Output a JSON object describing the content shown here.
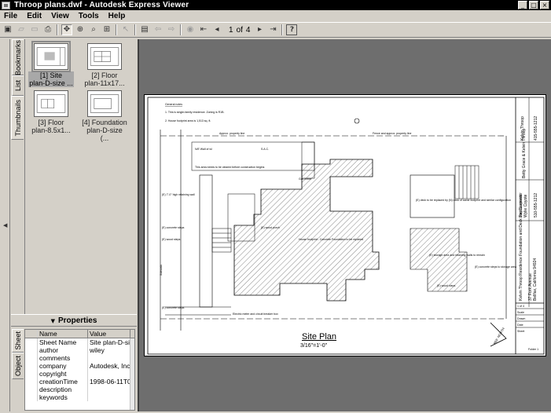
{
  "window": {
    "title": "Throop plans.dwf - Autodesk Express Viewer",
    "controls": [
      "_",
      "□",
      "×"
    ]
  },
  "menu": [
    "File",
    "Edit",
    "View",
    "Tools",
    "Help"
  ],
  "toolbar": {
    "page_current": "1",
    "page_of": "of",
    "page_total": "4"
  },
  "left_tabs": [
    "Bookmarks",
    "List",
    "Thumbnails"
  ],
  "thumbnails": [
    {
      "label": "[1] Site plan-D-size ...",
      "line1": "[1] Site",
      "line2": "plan-D-size ..."
    },
    {
      "label": "[2] Floor plan-11x17...",
      "line1": "[2] Floor",
      "line2": "plan-11x17..."
    },
    {
      "label": "[3] Floor plan-8.5x1...",
      "line1": "[3] Floor",
      "line2": "plan-8.5x1..."
    },
    {
      "label": "[4] Foundation plan-D-size (...",
      "line1": "[4] Foundation",
      "line2": "plan-D-size (..."
    }
  ],
  "properties": {
    "header": "Properties",
    "tabs": [
      "Sheet",
      "Object"
    ],
    "columns": [
      "Name",
      "Value"
    ],
    "rows": [
      {
        "name": "Sheet Name",
        "value": "Site plan-D-size l"
      },
      {
        "name": "author",
        "value": "wiley"
      },
      {
        "name": "comments",
        "value": ""
      },
      {
        "name": "company",
        "value": "Autodesk, Inc."
      },
      {
        "name": "copyright",
        "value": ""
      },
      {
        "name": "creationTime",
        "value": "1998-06-11T06:5"
      },
      {
        "name": "description",
        "value": ""
      },
      {
        "name": "keywords",
        "value": ""
      }
    ]
  },
  "drawing": {
    "title": "Site Plan",
    "scale": "3/16\"=1'-0\"",
    "notes_header": "General notes",
    "note1": "1. This is single-family residence. Zoning is R1B.",
    "note2": "2. House footprint area is 1,513 sq. ft.",
    "label_approx_property_line": "Approx. property line",
    "label_fence": "Fence and approx. property line",
    "label_walls": "N/E Wall of wl",
    "label_sac": "S.A.C.",
    "label_tree": "This area needs to be cleared before construction begins",
    "label_house": "House footprint - Concrete Foundation to be repaired",
    "label_gas": "Gas meter",
    "label_retaining": "(E) 7'-0\" high retaining wall",
    "label_concrete_steps": "(E) concrete steps",
    "label_wood_steps": "(E) wood steps",
    "label_wood_porch": "(E) wood porch",
    "label_sidewalk": "Sidewalk",
    "label_deck": "(E) deck to be replaced by (N) deck of same footprint and similar configuration",
    "label_storage": "(E) storage area and retaining walls to remain",
    "label_concrete_steps2": "(E) concrete steps to storage area",
    "label_wood_steps2": "(E) wood steps",
    "label_electric": "Electric meter and circuit breaker box",
    "label_north": "REF. NORTH",
    "tb_designer_h": "Designer:",
    "tb_designer": "Kelvin Throop",
    "tb_designer_ph": "415-555-1212",
    "tb_owner": "Betty Grace & Kelvin Throop",
    "tb_contractor_h": "Contractor:",
    "tb_contractor": "Joe Carpenter",
    "tb_contractor2": "Wylie Coyote",
    "tb_contractor_ph": "510-555-1212",
    "tb_project": "Kelvin Throop Residence Foundation and Deck Replacement",
    "tb_address": "37 Fork Avenue",
    "tb_city": "Bellfax, California 94924",
    "tb_sheet": "1 of 4",
    "tb_row_a": "Scale",
    "tb_row_b": "Drawn",
    "tb_row_c": "Date",
    "tb_row_d": "Sheet",
    "tb_folder": "Folder 1"
  }
}
